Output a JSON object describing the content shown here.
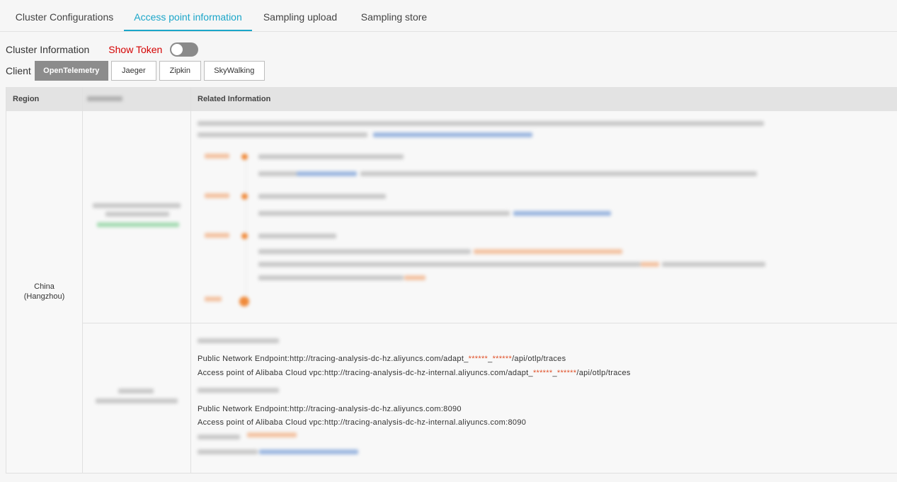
{
  "tabs": [
    {
      "label": "Cluster Configurations"
    },
    {
      "label": "Access point information",
      "active": true
    },
    {
      "label": "Sampling upload"
    },
    {
      "label": "Sampling store"
    }
  ],
  "cluster_info": {
    "label": "Cluster Information",
    "show_token": "Show Token",
    "toggle_on": false
  },
  "client": {
    "label": "Client",
    "options": [
      "OpenTelemetry",
      "Jaeger",
      "Zipkin",
      "SkyWalking"
    ],
    "selected": "OpenTelemetry"
  },
  "table": {
    "headers": {
      "region": "Region",
      "related": "Related Information"
    },
    "region": "China\n(Hangzhou)",
    "http": {
      "public_prefix": "Public Network Endpoint:http://tracing-analysis-dc-hz.aliyuncs.com/adapt_",
      "vpc_prefix": "Access point of Alibaba Cloud vpc:http://tracing-analysis-dc-hz-internal.aliyuncs.com/adapt_",
      "mask": "******",
      "sep": "_",
      "suffix": "/api/otlp/traces"
    },
    "grpc": {
      "public": "Public Network Endpoint:http://tracing-analysis-dc-hz.aliyuncs.com:8090",
      "vpc": "Access point of Alibaba Cloud vpc:http://tracing-analysis-dc-hz-internal.aliyuncs.com:8090"
    }
  },
  "colors": {
    "accent": "#1ba6c9",
    "token": "#d40000",
    "step_dot": "#f08a3a",
    "mask": "#e0522a"
  }
}
